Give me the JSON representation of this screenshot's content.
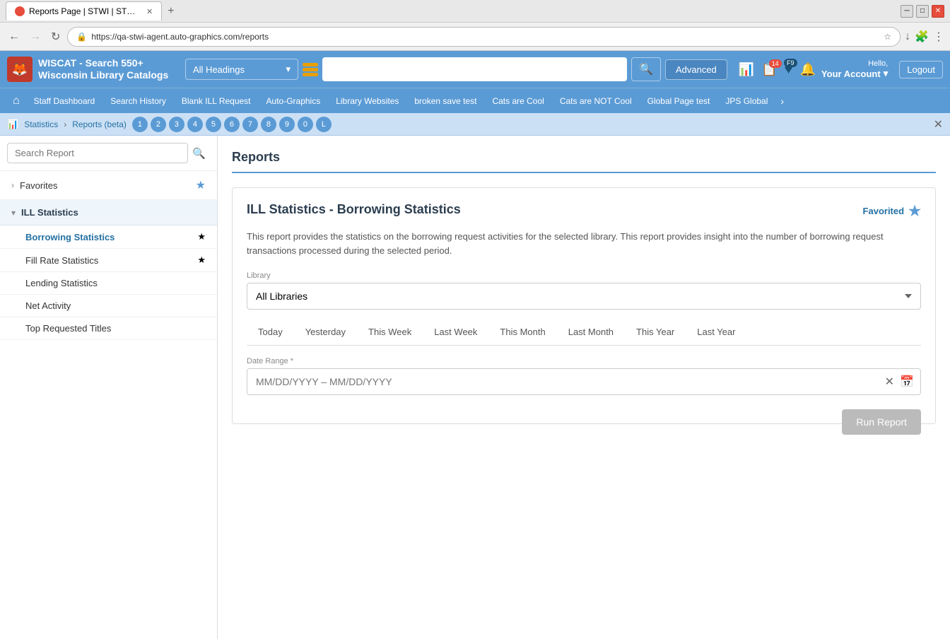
{
  "browser": {
    "tab_title": "Reports Page | STWI | STWI | Au...",
    "url": "https://qa-stwi-agent.auto-graphics.com/reports",
    "new_tab_label": "+"
  },
  "header": {
    "app_title": "WISCAT - Search 550+ Wisconsin Library Catalogs",
    "search_type": "All Headings",
    "advanced_label": "Advanced",
    "search_placeholder": "",
    "account_greeting": "Hello,",
    "account_name": "Your Account",
    "logout_label": "Logout",
    "notification_badge": "14",
    "f9_badge": "F9"
  },
  "nav": {
    "items": [
      "Staff Dashboard",
      "Search History",
      "Blank ILL Request",
      "Auto-Graphics",
      "Library Websites",
      "broken save test",
      "Cats are Cool",
      "Cats are NOT Cool",
      "Global Page test",
      "JPS Global"
    ]
  },
  "breadcrumb": {
    "statistics_label": "Statistics",
    "reports_label": "Reports (beta)",
    "page_numbers": [
      "1",
      "2",
      "3",
      "4",
      "5",
      "6",
      "7",
      "8",
      "9",
      "0",
      "L"
    ]
  },
  "sidebar": {
    "search_placeholder": "Search Report",
    "favorites_label": "Favorites",
    "ill_statistics_label": "ILL Statistics",
    "sub_items": [
      {
        "label": "Borrowing Statistics",
        "starred": true,
        "active": true
      },
      {
        "label": "Fill Rate Statistics",
        "starred": true,
        "active": false
      },
      {
        "label": "Lending Statistics",
        "starred": false,
        "active": false
      },
      {
        "label": "Net Activity",
        "starred": false,
        "active": false
      },
      {
        "label": "Top Requested Titles",
        "starred": false,
        "active": false
      }
    ]
  },
  "report": {
    "title": "ILL Statistics - Borrowing Statistics",
    "favorited_label": "Favorited",
    "description": "This report provides the statistics on the borrowing request activities for the selected library. This report provides insight into the number of borrowing request transactions processed during the selected period.",
    "library_label": "Library",
    "library_value": "All Libraries",
    "library_options": [
      "All Libraries"
    ],
    "date_tabs": [
      "Today",
      "Yesterday",
      "This Week",
      "Last Week",
      "This Month",
      "Last Month",
      "This Year",
      "Last Year"
    ],
    "date_range_label": "Date Range *",
    "date_range_placeholder": "MM/DD/YYYY – MM/DD/YYYY",
    "run_report_label": "Run Report"
  },
  "page_title": "Reports"
}
